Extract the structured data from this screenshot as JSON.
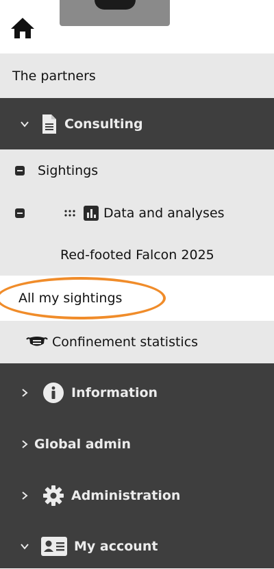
{
  "header": {
    "home_icon": "home-icon",
    "avatar_icon": "user-avatar-icon"
  },
  "menu": {
    "partners": "The partners",
    "consulting": "Consulting",
    "sightings": "Sightings",
    "data_analyses": "Data and analyses",
    "red_falcon": "Red-footed Falcon 2025",
    "all_sightings": "All my sightings",
    "confinement": "Confinement statistics",
    "information": "Information",
    "global_admin": "Global admin",
    "administration": "Administration",
    "my_account": "My account"
  },
  "colors": {
    "highlight": "#f08c2a",
    "dark_bg": "#3e3e3e",
    "light_bg": "#e8e8e8"
  }
}
